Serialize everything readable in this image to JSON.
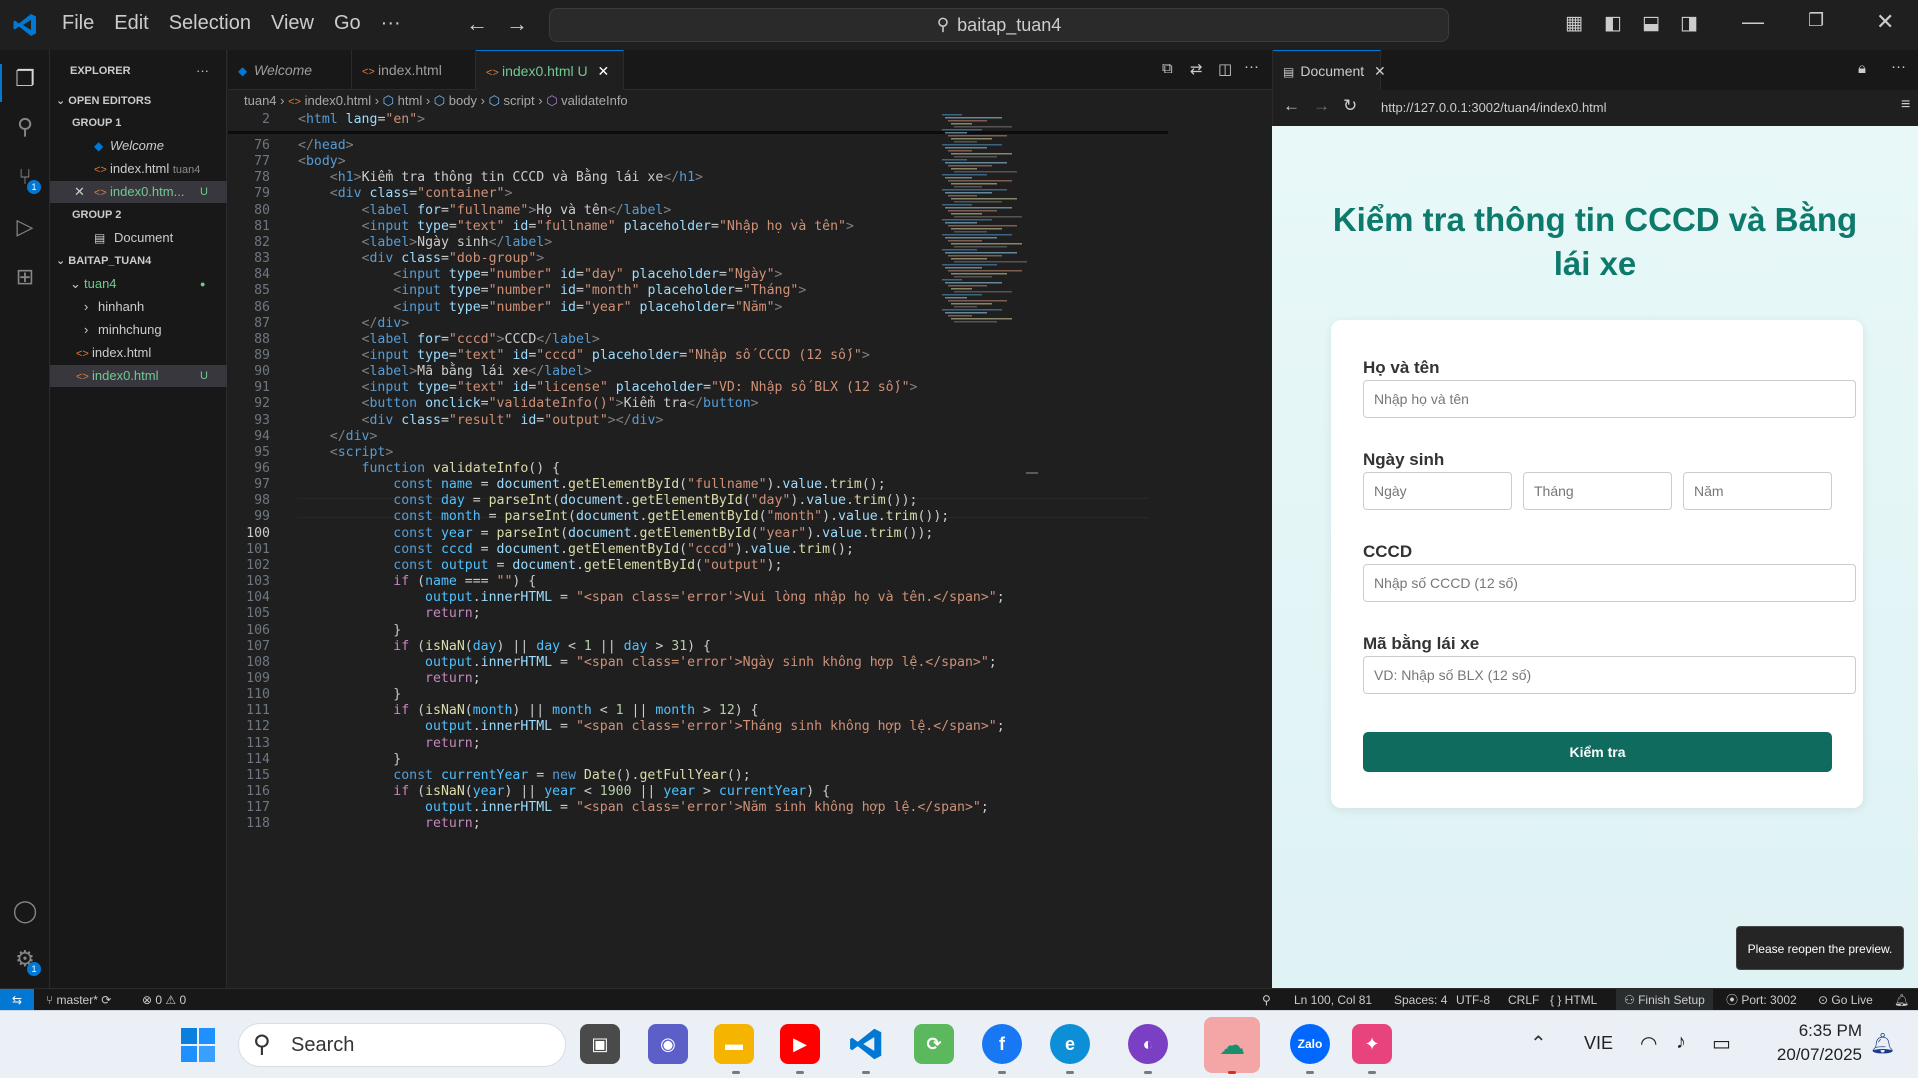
{
  "titlebar": {
    "menus": [
      "File",
      "Edit",
      "Selection",
      "View",
      "Go"
    ],
    "more": "···",
    "search_text": "baitap_tuan4"
  },
  "activity": {
    "scm_badge": "1",
    "settings_badge": "1"
  },
  "explorer": {
    "title": "EXPLORER",
    "more": "···",
    "open_editors": "OPEN EDITORS",
    "group1": "GROUP 1",
    "g1_items": [
      {
        "name": "Welcome",
        "desc": ""
      },
      {
        "name": "index.html",
        "desc": "tuan4"
      },
      {
        "name": "index0.htm...",
        "desc": "U"
      }
    ],
    "group2": "GROUP 2",
    "g2_items": [
      {
        "name": "Document"
      }
    ],
    "project": "BAITAP_TUAN4",
    "tree": [
      {
        "name": "tuan4",
        "badge": "●"
      },
      {
        "name": "hinhanh"
      },
      {
        "name": "minhchung"
      },
      {
        "name": "index.html"
      },
      {
        "name": "index0.html",
        "badge": "U"
      }
    ]
  },
  "tabs": [
    {
      "label": "Welcome"
    },
    {
      "label": "index.html"
    },
    {
      "label": "index0.html",
      "flag": "U",
      "close": "✕"
    }
  ],
  "breadcrumb": [
    "tuan4",
    "index0.html",
    "html",
    "body",
    "script",
    "validateInfo"
  ],
  "code": {
    "sticky_num": "2",
    "sticky_line": "<html lang=\"en\">",
    "start": 76,
    "current": 100
  },
  "preview": {
    "tab_label": "Document",
    "tab_close": "✕",
    "url": "http://127.0.0.1:3002/tuan4/index0.html",
    "title": "Kiểm tra thông tin CCCD và Bằng lái xe",
    "label_name": "Họ và tên",
    "ph_name": "Nhập họ và tên",
    "label_dob": "Ngày sinh",
    "ph_day": "Ngày",
    "ph_month": "Tháng",
    "ph_year": "Năm",
    "label_cccd": "CCCD",
    "ph_cccd": "Nhập số CCCD (12 số)",
    "label_license": "Mã bằng lái xe",
    "ph_license": "VD: Nhập số BLX (12 số)",
    "button": "Kiểm tra",
    "toast": "Please reopen the preview."
  },
  "status": {
    "branch": "master*",
    "problems": "⊗ 0 ⚠ 0",
    "position": "Ln 100, Col 81",
    "spaces": "Spaces: 4",
    "encoding": "UTF-8",
    "eol": "CRLF",
    "language": "{ } HTML",
    "finish": "Finish Setup",
    "port": "Port: 3002",
    "golive": "Go Live"
  },
  "taskbar": {
    "search": "Search",
    "lang": "VIE",
    "time": "6:35 PM",
    "date": "20/07/2025"
  }
}
